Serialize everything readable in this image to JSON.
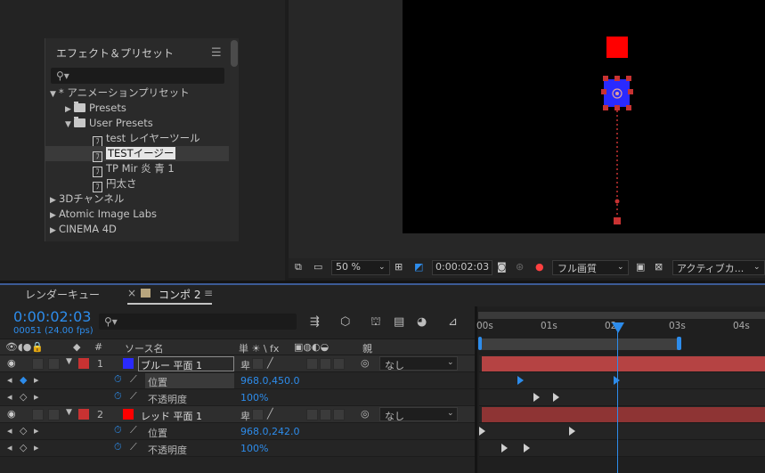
{
  "effects_panel": {
    "title": "エフェクト＆プリセット",
    "menu_icon": "hamburger-icon",
    "search_placeholder": "",
    "tree": [
      {
        "label": "* アニメーションプリセット",
        "expanded": true
      },
      {
        "label": "Presets",
        "expanded": false
      },
      {
        "label": "User Presets",
        "expanded": true
      },
      {
        "label": "test レイヤーツール"
      },
      {
        "label": "TESTイージー",
        "selected": true
      },
      {
        "label": "TP Mir 炎 青 1"
      },
      {
        "label": "円太さ"
      },
      {
        "label": "3Dチャンネル",
        "expanded": false
      },
      {
        "label": "Atomic Image Labs",
        "expanded": false
      },
      {
        "label": "CINEMA 4D",
        "expanded": false
      }
    ]
  },
  "viewer": {
    "zoom": "50 %",
    "timecode": "0:00:02:03",
    "resolution": "フル画質",
    "view": "アクティブカ...",
    "colors": {
      "blue_solid": "#2222ff",
      "red_solid": "#ff0000",
      "handle": "#c83232"
    }
  },
  "timeline": {
    "tabs": [
      {
        "label": "レンダーキュー",
        "active": false
      },
      {
        "label": "コンポ 2",
        "active": true
      }
    ],
    "timecode": "0:00:02:03",
    "frame_info": "00051 (24.00 fps)",
    "columns": {
      "number": "#",
      "source_name": "ソース名",
      "switches": "単 ☀ \\ fx",
      "parent": "親"
    },
    "ruler": {
      "labels": [
        "00s",
        "01s",
        "02s",
        "03s",
        "04s"
      ],
      "current_time_s": 2.125
    },
    "layers": [
      {
        "number": "1",
        "name": "ブルー 平面 1",
        "label_color": "#c83232",
        "solid_color": "#2a2aff",
        "parent": "なし",
        "properties": [
          {
            "name": "位置",
            "value": "968.0,450.0",
            "keyframes_s": [
              0.6,
              2.1
            ]
          },
          {
            "name": "不透明度",
            "value": "100%",
            "keyframes_s": [
              0.85,
              1.15
            ]
          }
        ]
      },
      {
        "number": "2",
        "name": "レッド 平面 1",
        "label_color": "#c83232",
        "solid_color": "#ff0000",
        "parent": "なし",
        "properties": [
          {
            "name": "位置",
            "value": "968.0,242.0",
            "keyframes_s": [
              0.0,
              1.4
            ]
          },
          {
            "name": "不透明度",
            "value": "100%",
            "keyframes_s": [
              0.35,
              0.7
            ]
          }
        ]
      }
    ]
  }
}
